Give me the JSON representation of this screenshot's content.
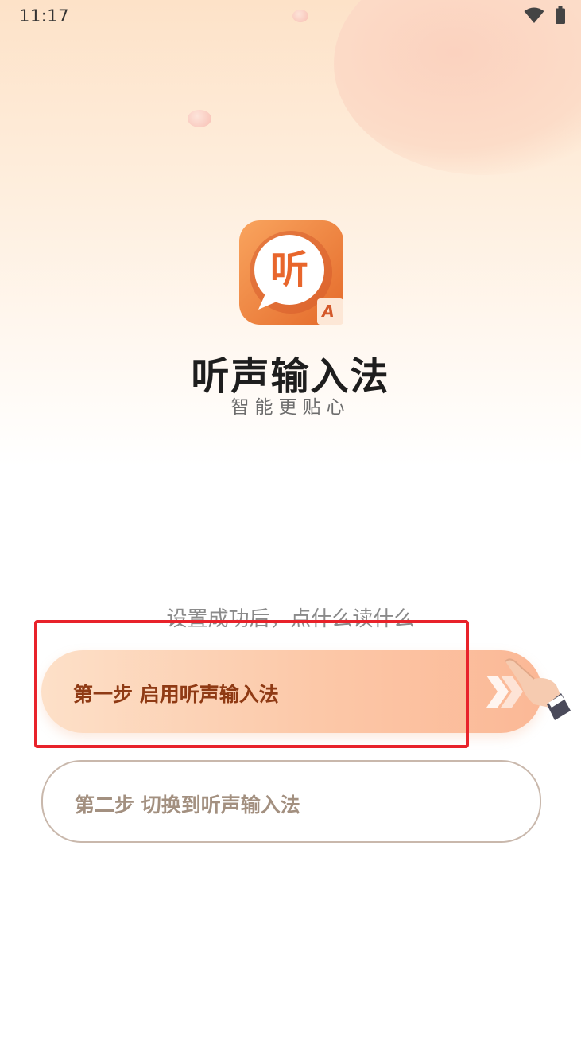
{
  "status_bar": {
    "time": "11:17"
  },
  "app": {
    "icon_glyph": "听",
    "icon_badge": "A",
    "name": "听声输入法",
    "slogan": "智能更贴心"
  },
  "setup": {
    "hint": "设置成功后，点什么读什么",
    "step1_label": "第一步 启用听声输入法",
    "step2_label": "第二步 切换到听声输入法"
  },
  "colors": {
    "accent": "#f07a3a",
    "step1_text": "#8f3a14",
    "highlight": "#e8222a"
  }
}
